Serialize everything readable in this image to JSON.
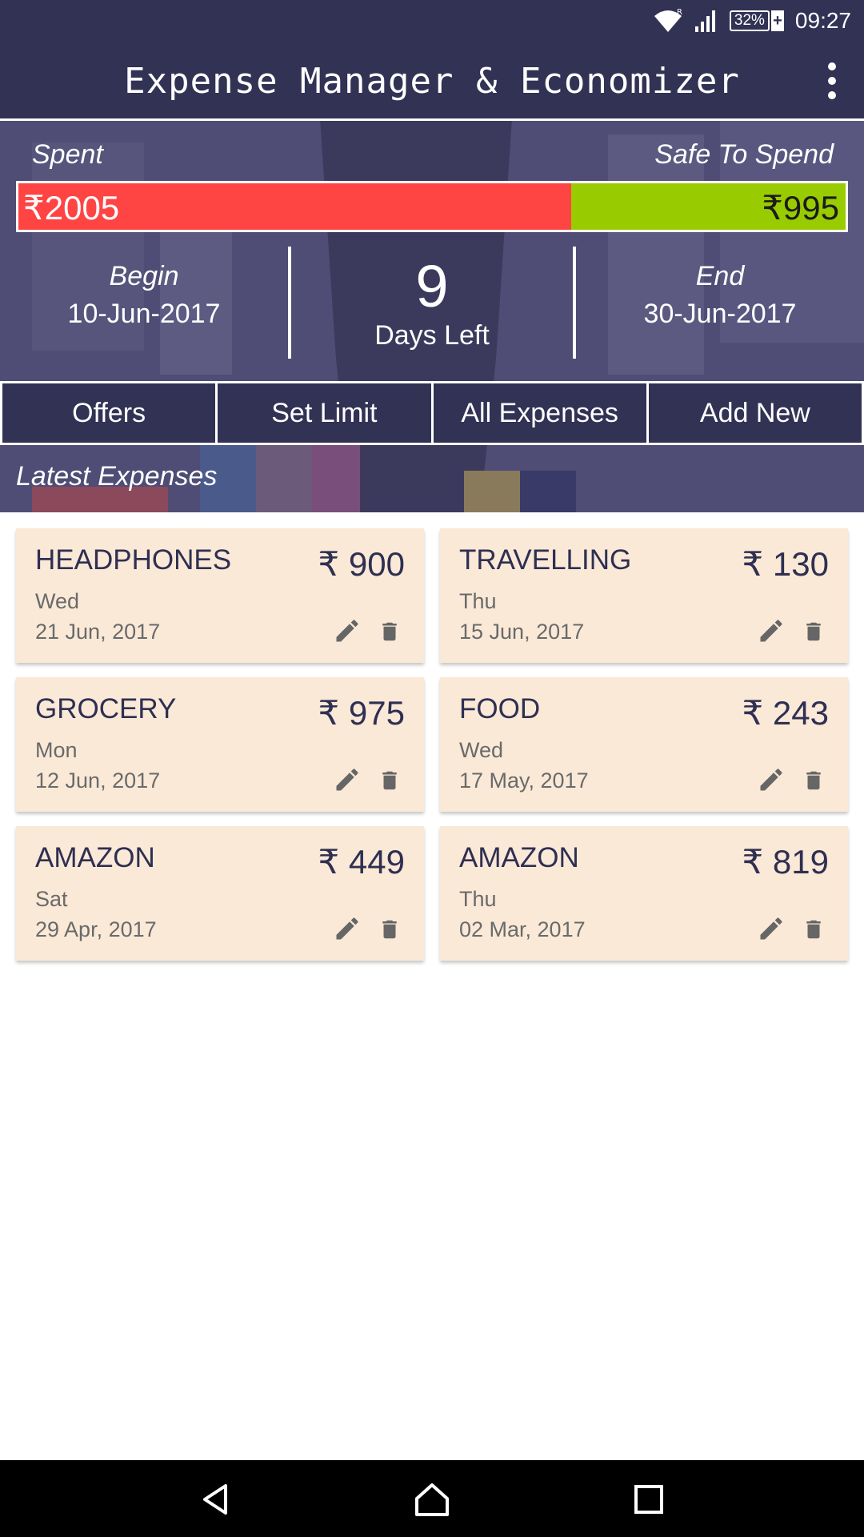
{
  "status_bar": {
    "time": "09:27",
    "battery": "32%",
    "icons": [
      "wifi-icon",
      "signal-icon",
      "battery-charging-icon"
    ]
  },
  "app_bar": {
    "title": "Expense Manager & Economizer",
    "menu_icon": "more-vert-icon"
  },
  "budget": {
    "spent_label": "Spent",
    "safe_label": "Safe To Spend",
    "spent_amount": "₹2005",
    "safe_amount": "₹995",
    "spent_fraction": 0.668,
    "spent_color": "#ff4444",
    "safe_color": "#99cc00"
  },
  "period": {
    "begin_label": "Begin",
    "begin_date": "10-Jun-2017",
    "days_left": "9",
    "days_left_label": "Days Left",
    "end_label": "End",
    "end_date": "30-Jun-2017"
  },
  "actions": {
    "offers": "Offers",
    "set_limit": "Set Limit",
    "all_expenses": "All Expenses",
    "add_new": "Add New"
  },
  "latest": {
    "title": "Latest Expenses",
    "items": [
      {
        "name": "HEADPHONES",
        "amount": "₹ 900",
        "day": "Wed",
        "date": "21 Jun, 2017"
      },
      {
        "name": "TRAVELLING",
        "amount": "₹ 130",
        "day": "Thu",
        "date": "15 Jun, 2017"
      },
      {
        "name": "GROCERY",
        "amount": "₹ 975",
        "day": "Mon",
        "date": "12 Jun, 2017"
      },
      {
        "name": "FOOD",
        "amount": "₹ 243",
        "day": "Wed",
        "date": "17 May, 2017"
      },
      {
        "name": "AMAZON",
        "amount": "₹ 449",
        "day": "Sat",
        "date": "29 Apr, 2017"
      },
      {
        "name": "AMAZON",
        "amount": "₹ 819",
        "day": "Thu",
        "date": "02 Mar, 2017"
      }
    ]
  },
  "theme": {
    "primary": "#323255",
    "card": "#fae9d7"
  },
  "nav": {
    "icons": [
      "back-icon",
      "home-icon",
      "recents-icon"
    ]
  }
}
